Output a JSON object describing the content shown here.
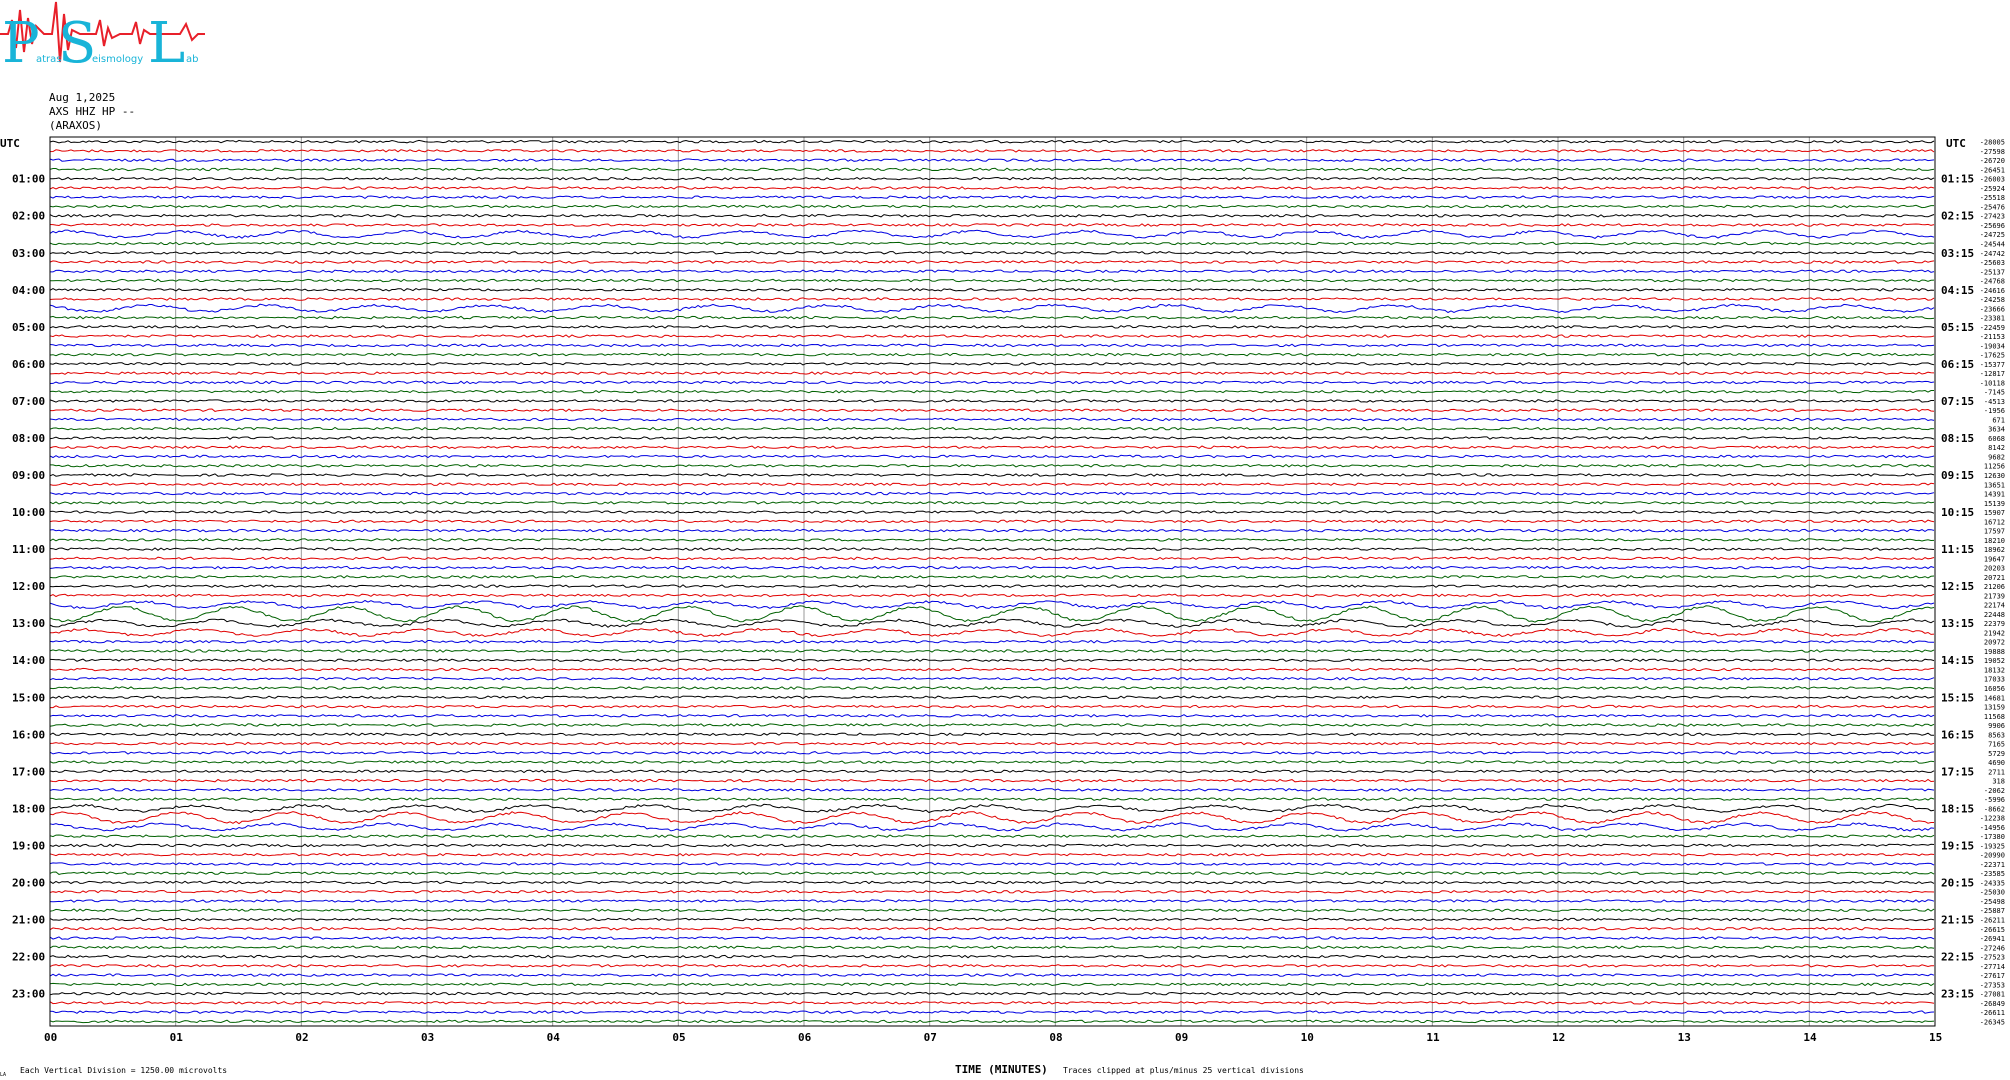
{
  "logo": {
    "letters": [
      "P",
      "S",
      "L"
    ],
    "small_text": [
      "atras",
      "eismology",
      "ab"
    ],
    "colors": {
      "letters": "#19b4d8",
      "wave": "#e8202a"
    }
  },
  "header": {
    "date": "Aug 1,2025",
    "station": "AXS HHZ HP --",
    "site": "(ARAXOS)"
  },
  "labels": {
    "utc_left": "UTC",
    "utc_right": "UTC",
    "xlabel": "TIME (MINUTES)",
    "clip_note": "Traces clipped at plus/minus 25 vertical divisions",
    "scale_note": "Each Vertical Division = 1250.00 microvolts",
    "corner": "LA"
  },
  "chart_data": {
    "type": "line",
    "xlabel": "TIME (MINUTES)",
    "xlim": [
      0,
      15
    ],
    "x_ticks": [
      "00",
      "01",
      "02",
      "03",
      "04",
      "05",
      "06",
      "07",
      "08",
      "09",
      "10",
      "11",
      "12",
      "13",
      "14",
      "15"
    ],
    "trace_colors": [
      "#000000",
      "#e00000",
      "#0000e0",
      "#006000"
    ],
    "hour_labels_left": [
      "01:00",
      "02:00",
      "03:00",
      "04:00",
      "05:00",
      "06:00",
      "07:00",
      "08:00",
      "09:00",
      "10:00",
      "11:00",
      "12:00",
      "13:00",
      "14:00",
      "15:00",
      "16:00",
      "17:00",
      "18:00",
      "19:00",
      "20:00",
      "21:00",
      "22:00",
      "23:00"
    ],
    "hour_labels_right": [
      "01:15",
      "02:15",
      "03:15",
      "04:15",
      "05:15",
      "06:15",
      "07:15",
      "08:15",
      "09:15",
      "10:15",
      "11:15",
      "12:15",
      "13:15",
      "14:15",
      "15:15",
      "16:15",
      "17:15",
      "18:15",
      "19:15",
      "20:15",
      "21:15",
      "22:15",
      "23:15"
    ],
    "trace_offsets": [
      -28005,
      -27598,
      -26720,
      -26451,
      -26003,
      -25924,
      -25518,
      -25476,
      -27423,
      -25696,
      -24725,
      -24544,
      -24742,
      -25603,
      -25137,
      -24768,
      -24616,
      -24258,
      -23666,
      -23381,
      -22459,
      -21153,
      -19034,
      -17625,
      -15377,
      -12817,
      -10118,
      -7145,
      -4513,
      -1956,
      671,
      3634,
      6068,
      8142,
      9682,
      11256,
      12630,
      13651,
      14391,
      15139,
      15907,
      16712,
      17597,
      18210,
      18962,
      19647,
      20203,
      20721,
      21206,
      21739,
      22174,
      22448,
      22379,
      21942,
      20972,
      19888,
      19052,
      18132,
      17033,
      16056,
      14681,
      13159,
      11568,
      9906,
      8563,
      7165,
      5729,
      4690,
      2711,
      318,
      -2062,
      -5996,
      -8662,
      -12238,
      -14956,
      -17380,
      -19325,
      -20990,
      -22371,
      -23585,
      -24335,
      -25030,
      -25498,
      -25887,
      -26211,
      -26615,
      -26941,
      -27246,
      -27523,
      -27714,
      -27617,
      -27353,
      -27081,
      -26849,
      -26611,
      -26345
    ]
  }
}
